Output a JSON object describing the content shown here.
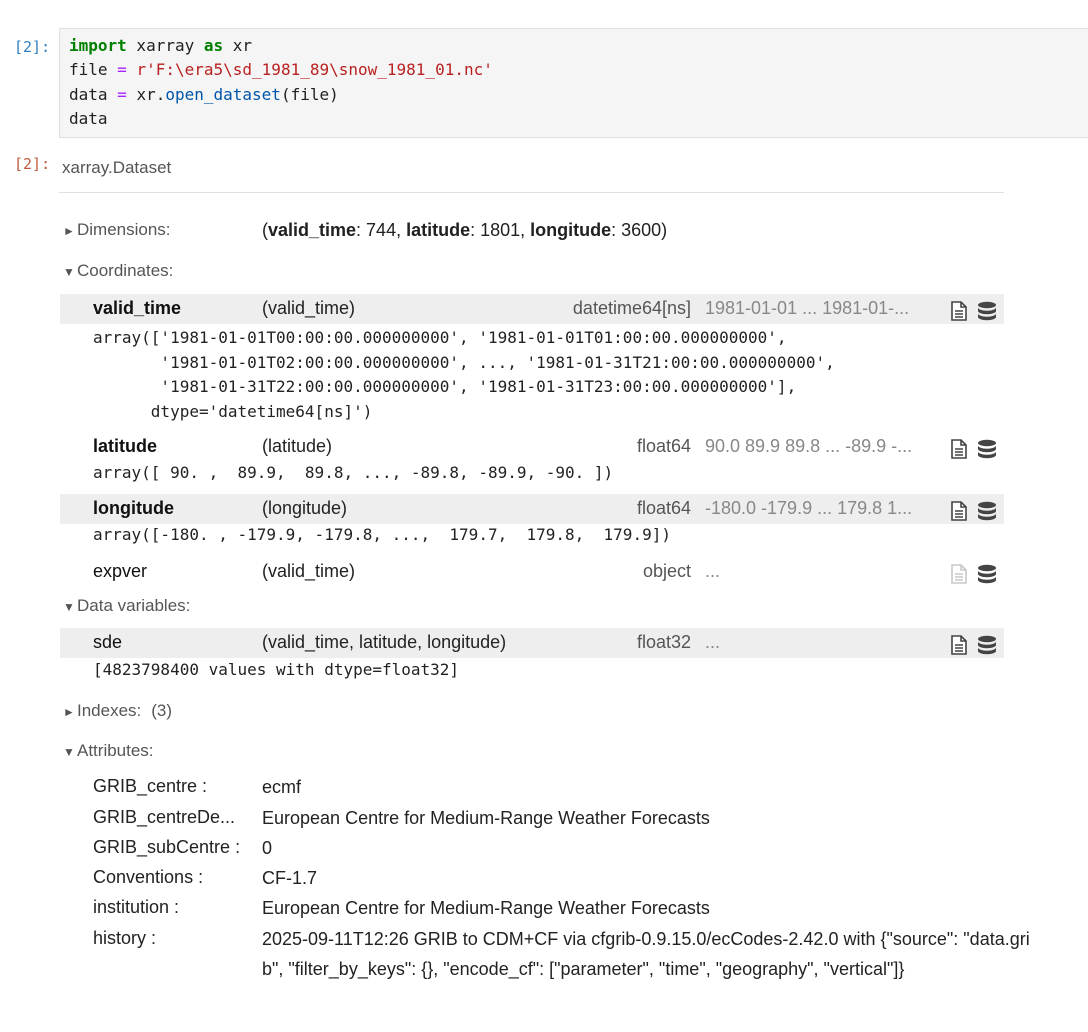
{
  "input_cell": {
    "prompt": "[2]:",
    "code": {
      "line1": {
        "kw1": "import",
        "mod": " xarray ",
        "kw2": "as",
        "alias": " xr"
      },
      "line2": {
        "var": "file ",
        "op": "=",
        "str": " r'F:\\era5\\sd_1981_89\\snow_1981_01.nc'"
      },
      "line3": {
        "var": "data ",
        "op": "=",
        "obj": " xr.",
        "fn": "open_dataset",
        "args": "(file)"
      },
      "line4": "data"
    }
  },
  "output_cell": {
    "prompt": "[2]:",
    "header": "xarray.Dataset",
    "dimensions": {
      "label": "Dimensions:",
      "open": "(",
      "d1_name": "valid_time",
      "d1_size": ": 744, ",
      "d2_name": "latitude",
      "d2_size": ": 1801, ",
      "d3_name": "longitude",
      "d3_size": ": 3600)"
    },
    "coordinates": {
      "label": "Coordinates:",
      "vars": [
        {
          "name": "valid_time",
          "dims": "(valid_time)",
          "dtype": "datetime64[ns]",
          "preview": "1981-01-01 ... 1981-01-...",
          "array": "array(['1981-01-01T00:00:00.000000000', '1981-01-01T01:00:00.000000000',\n       '1981-01-01T02:00:00.000000000', ..., '1981-01-31T21:00:00.000000000',\n       '1981-01-31T22:00:00.000000000', '1981-01-31T23:00:00.000000000'],\n      dtype='datetime64[ns]')"
        },
        {
          "name": "latitude",
          "dims": "(latitude)",
          "dtype": "float64",
          "preview": "90.0 89.9 89.8 ... -89.9 -...",
          "array": "array([ 90. ,  89.9,  89.8, ..., -89.8, -89.9, -90. ])"
        },
        {
          "name": "longitude",
          "dims": "(longitude)",
          "dtype": "float64",
          "preview": "-180.0 -179.9 ... 179.8 1...",
          "array": "array([-180. , -179.9, -179.8, ...,  179.7,  179.8,  179.9])"
        },
        {
          "name": "expver",
          "dims": "(valid_time)",
          "dtype": "object",
          "preview": "..."
        }
      ]
    },
    "data_variables": {
      "label": "Data variables:",
      "vars": [
        {
          "name": "sde",
          "dims": "(valid_time, latitude, longitude)",
          "dtype": "float32",
          "preview": "...",
          "array": "[4823798400 values with dtype=float32]"
        }
      ]
    },
    "indexes": {
      "label": "Indexes:",
      "count": "(3)"
    },
    "attributes": {
      "label": "Attributes:",
      "items": [
        {
          "key": "GRIB_centre :",
          "value": "ecmf"
        },
        {
          "key": "GRIB_centreDe...",
          "value": "European Centre for Medium-Range Weather Forecasts"
        },
        {
          "key": "GRIB_subCentre :",
          "value": "0"
        },
        {
          "key": "Conventions :",
          "value": "CF-1.7"
        },
        {
          "key": "institution :",
          "value": "European Centre for Medium-Range Weather Forecasts"
        },
        {
          "key": "history :",
          "value": "2025-09-11T12:26 GRIB to CDM+CF via cfgrib-0.9.15.0/ecCodes-2.42.0 with {\"source\": \"data.grib\", \"filter_by_keys\": {}, \"encode_cf\": [\"parameter\", \"time\", \"geography\", \"vertical\"]}"
        }
      ]
    }
  },
  "icons": {
    "attrs": "file-text-icon",
    "data": "database-icon"
  },
  "colors": {
    "in_prompt": "#307fc1",
    "out_prompt": "#bf5b3d",
    "keyword": "#008000",
    "string": "#ba2121",
    "function": "#0055aa",
    "row_shade": "#eeeeee"
  }
}
